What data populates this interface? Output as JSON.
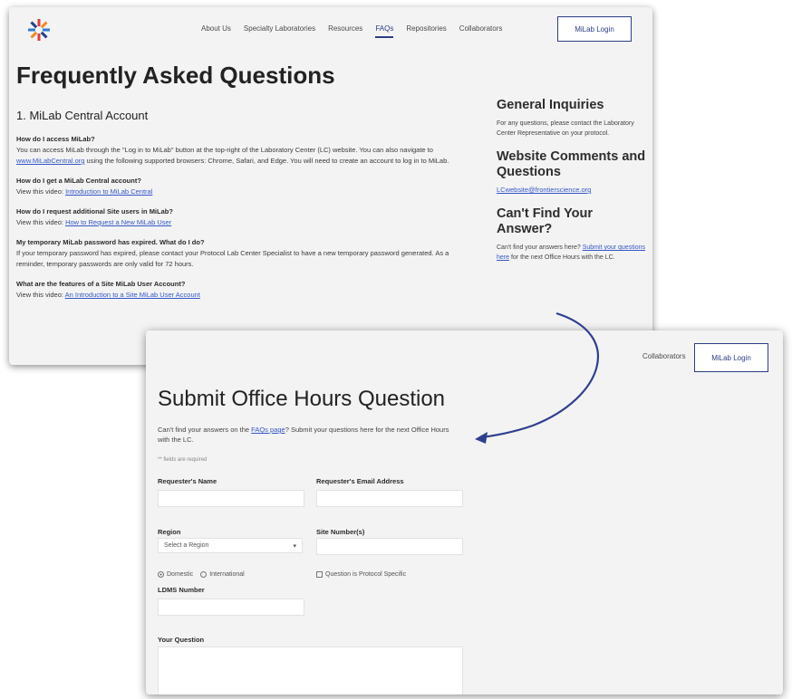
{
  "faq_page": {
    "nav": [
      "About Us",
      "Specialty Laboratories",
      "Resources",
      "FAQs",
      "Repositories",
      "Collaborators"
    ],
    "active_nav": "FAQs",
    "login_label": "MiLab Login",
    "title": "Frequently Asked Questions",
    "section_title": "1. MiLab Central Account",
    "faqs": [
      {
        "q": "How do I access MiLab?",
        "a_before": "You can access MiLab through the \"Log in to MiLab\" button at the top-right of the Laboratory Center (LC) website. You can also navigate to ",
        "a_link": "www.MiLabCentral.org",
        "a_after": " using the following supported browsers: Chrome, Safari, and Edge. You will need to create an account to log in to MiLab."
      },
      {
        "q": "How do I get a MiLab Central account?",
        "a_before": "View this video: ",
        "a_link": "Introduction to MiLab Central",
        "a_after": ""
      },
      {
        "q": "How do I request additional Site users in MiLab?",
        "a_before": "View this video: ",
        "a_link": "How to Request a New MiLab User",
        "a_after": ""
      },
      {
        "q": "My temporary MiLab password has expired. What do I do?",
        "a_before": "If your temporary password has expired, please contact your Protocol Lab Center Specialist to have a new temporary password generated. As a reminder, temporary passwords are only valid for 72 hours.",
        "a_link": "",
        "a_after": ""
      },
      {
        "q": "What are the features of a Site MiLab User Account?",
        "a_before": "View this video: ",
        "a_link": "An Introduction to a Site MiLab User Account",
        "a_after": ""
      }
    ],
    "sidebar": {
      "general_heading": "General Inquiries",
      "general_text": "For any questions, please contact the Laboratory Center Representative on your protocol.",
      "comments_heading": "Website Comments and Questions",
      "comments_email": "LCwebsite@frontierscience.org",
      "cantfind_heading": "Can't Find Your Answer?",
      "cantfind_before": "Can't find your answers here? ",
      "cantfind_link": "Submit your questions here",
      "cantfind_after": " for the next Office Hours with the LC."
    }
  },
  "office_hours_page": {
    "nav_partial": "Collaborators",
    "login_label": "MiLab Login",
    "title": "Submit Office Hours Question",
    "intro_before": "Can't find your answers on the ",
    "intro_link": "FAQs page",
    "intro_after": "? Submit your questions here for the next Office Hours with the LC.",
    "required_note": "** fields are required",
    "fields": {
      "name_label": "Requester's Name",
      "email_label": "Requester's Email Address",
      "region_label": "Region",
      "region_placeholder": "Select a Region",
      "site_label": "Site Number(s)",
      "domestic_label": "Domestic",
      "international_label": "International",
      "protocol_label": "Question is Protocol Specific",
      "ldms_label": "LDMS Number",
      "question_label": "Your Question"
    }
  },
  "colors": {
    "accent": "#2c3e83",
    "link": "#3557c8",
    "arrow": "#2f3f8f"
  }
}
